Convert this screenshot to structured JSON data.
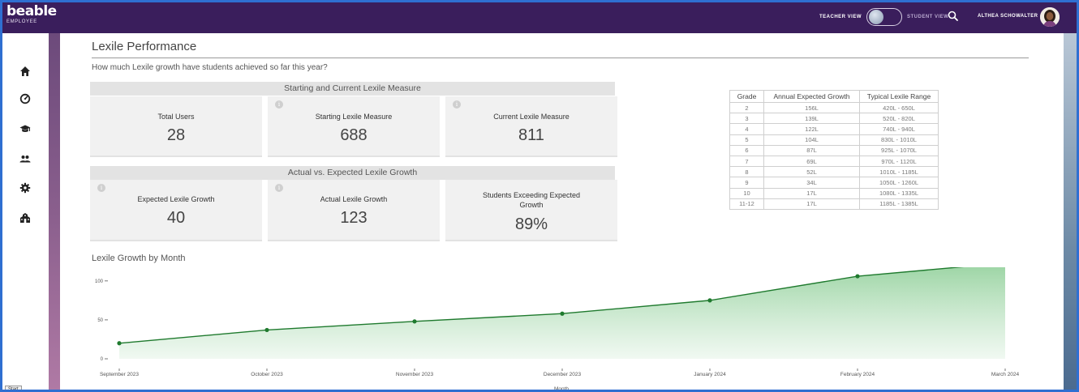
{
  "app": {
    "logo": "beable",
    "logo_sub": "EMPLOYEE"
  },
  "header": {
    "teacher_view": "TEACHER VIEW",
    "student_view": "STUDENT VIEW",
    "user_name": "ALTHEA SCHOWALTER",
    "search_icon": "search-icon"
  },
  "sidebar": {
    "items": [
      {
        "icon": "home-icon"
      },
      {
        "icon": "dashboard-gauge-icon"
      },
      {
        "icon": "graduation-cap-icon"
      },
      {
        "icon": "users-icon"
      },
      {
        "icon": "gear-icon"
      },
      {
        "icon": "school-building-icon"
      }
    ]
  },
  "taskbar": {
    "start_label": "Start"
  },
  "page": {
    "title": "Lexile Performance",
    "question": "How much Lexile growth have students achieved so far this year?"
  },
  "section1": {
    "title": "Starting and Current Lexile Measure",
    "cards": [
      {
        "label": "Total Users",
        "value": "28",
        "info": false
      },
      {
        "label": "Starting Lexile Measure",
        "value": "688",
        "info": true
      },
      {
        "label": "Current Lexile Measure",
        "value": "811",
        "info": true
      }
    ]
  },
  "section2": {
    "title": "Actual vs. Expected Lexile Growth",
    "cards": [
      {
        "label": "Expected Lexile Growth",
        "value": "40",
        "info": true
      },
      {
        "label": "Actual Lexile Growth",
        "value": "123",
        "info": true
      },
      {
        "label": "Students Exceeding Expected Growth",
        "value": "89%",
        "info": false
      }
    ]
  },
  "lexile_table": {
    "headers": [
      "Grade",
      "Annual Expected Growth",
      "Typical Lexile Range"
    ],
    "rows": [
      [
        "2",
        "156L",
        "420L - 650L"
      ],
      [
        "3",
        "139L",
        "520L - 820L"
      ],
      [
        "4",
        "122L",
        "740L - 940L"
      ],
      [
        "5",
        "104L",
        "830L - 1010L"
      ],
      [
        "6",
        "87L",
        "925L - 1070L"
      ],
      [
        "7",
        "69L",
        "970L - 1120L"
      ],
      [
        "8",
        "52L",
        "1010L - 1185L"
      ],
      [
        "9",
        "34L",
        "1050L - 1260L"
      ],
      [
        "10",
        "17L",
        "1080L - 1335L"
      ],
      [
        "11-12",
        "17L",
        "1185L - 1385L"
      ]
    ]
  },
  "chart_title": "Lexile Growth by Month",
  "chart_data": {
    "type": "area",
    "x": [
      "September 2023",
      "October 2023",
      "November 2023",
      "December 2023",
      "January 2024",
      "February 2024",
      "March 2024"
    ],
    "values": [
      20,
      37,
      48,
      58,
      75,
      106,
      123
    ],
    "xlabel": "Month",
    "ylabel": "",
    "yticks": [
      0,
      50,
      100
    ],
    "ylim": [
      0,
      130
    ],
    "grid": false,
    "colors": {
      "line": "#1f7a2e",
      "fill_top": "#8fcf98",
      "fill_bottom": "#eaf6ec"
    }
  },
  "colors": {
    "topbar": "#3a1e5c",
    "accent_green": "#1f7a2e",
    "card_bg": "#f1f1f1",
    "band_bg": "#e3e3e3"
  }
}
